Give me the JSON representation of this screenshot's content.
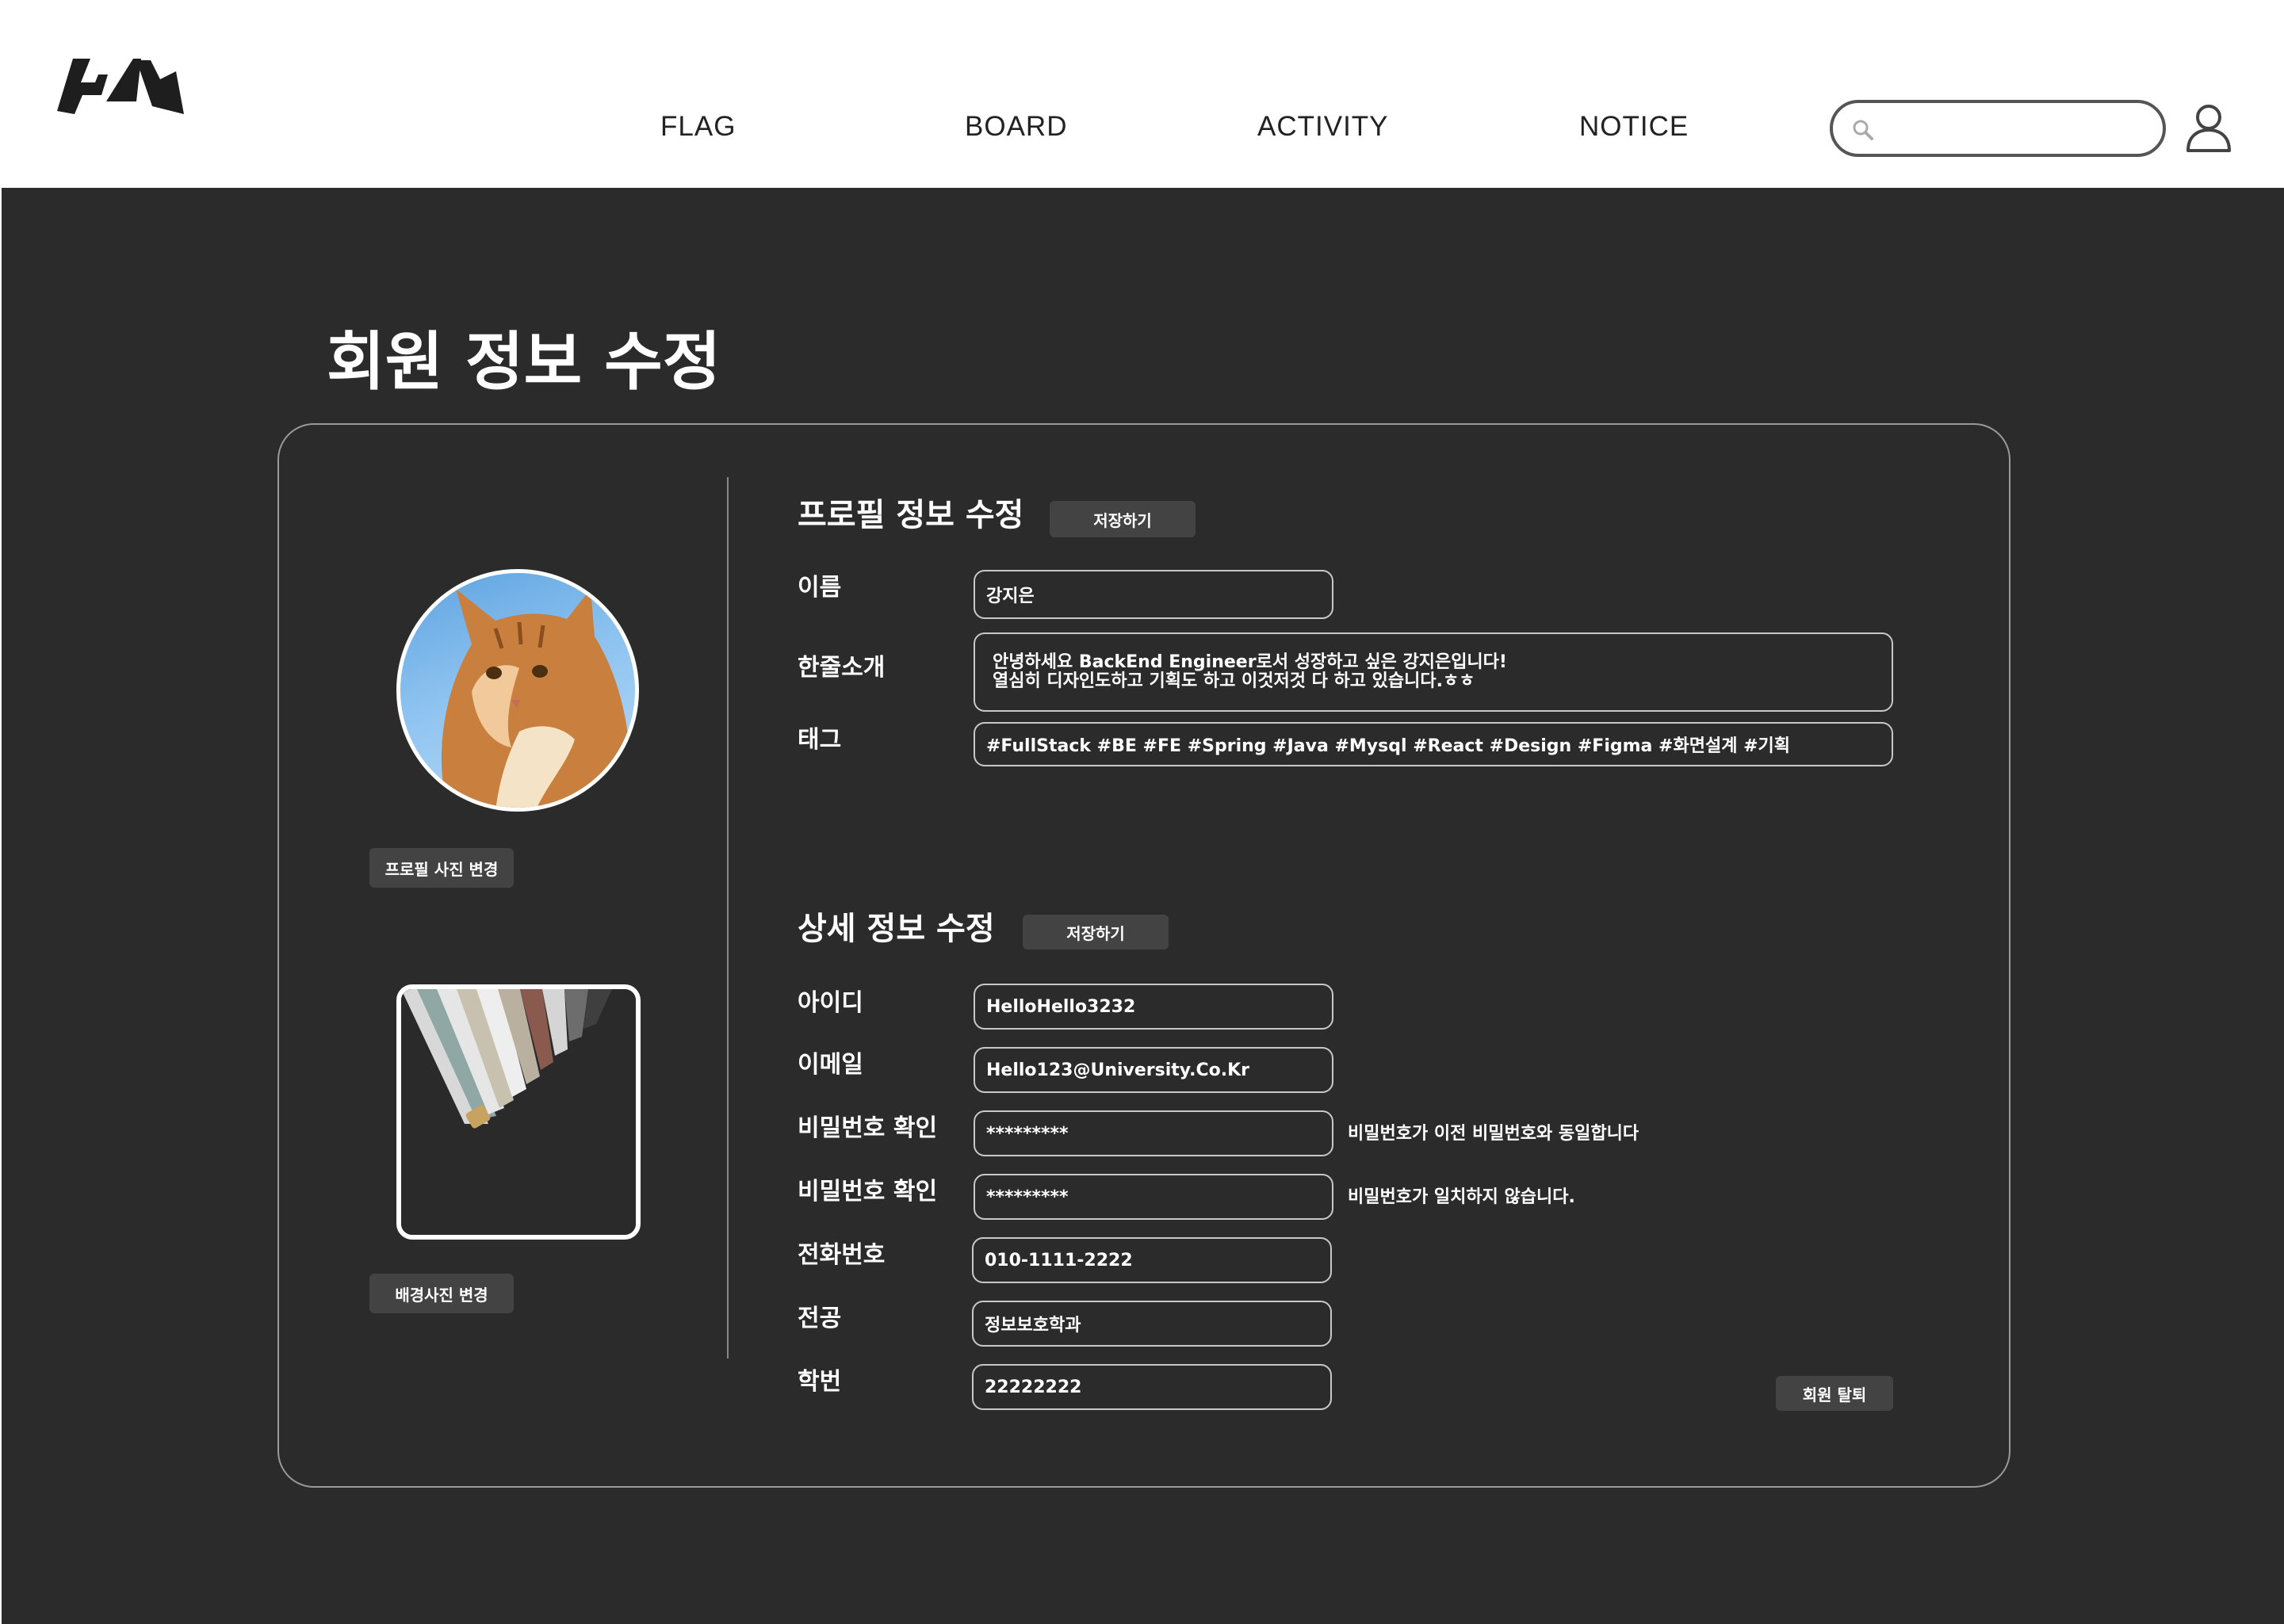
{
  "header": {
    "nav": [
      "FLAG",
      "BOARD",
      "ACTIVITY",
      "NOTICE"
    ],
    "search": {
      "value": "",
      "placeholder": ""
    }
  },
  "page": {
    "title": "회원 정보 수정"
  },
  "left_panel": {
    "profile_photo_button": "프로필 사진 변경",
    "background_photo_button": "배경사진  변경"
  },
  "profile_section": {
    "title": "프로필 정보 수정",
    "save_label": "저장하기",
    "fields": {
      "name": {
        "label": "이름",
        "value": "강지은"
      },
      "intro": {
        "label": "한줄소개",
        "line1": "안녕하세요  BackEnd Engineer로서 성장하고 싶은 강지은입니다!",
        "line2": "열심히 디자인도하고 기획도 하고 이것저것 다 하고 있습니다.ㅎㅎ"
      },
      "tags": {
        "label": "태그",
        "value": "#FullStack #BE #FE #Spring #Java #Mysql #React #Design #Figma #화면설계 #기획"
      }
    }
  },
  "detail_section": {
    "title": "상세 정보 수정",
    "save_label": "저장하기",
    "fields": {
      "user_id": {
        "label": "아이디",
        "value": "HelloHello3232"
      },
      "email": {
        "label": "이메일",
        "value": "Hello123@University.Co.Kr"
      },
      "password_confirm_1": {
        "label": "비밀번호 확인",
        "value": "*********",
        "hint": "비밀번호가 이전 비밀번호와 동일합니다"
      },
      "password_confirm_2": {
        "label": "비밀번호 확인",
        "value": "*********",
        "hint": "비밀번호가 일치하지 않습니다."
      },
      "phone": {
        "label": "전화번호",
        "value": "010-1111-2222"
      },
      "major": {
        "label": "전공",
        "value": "정보보호학과"
      },
      "student_no": {
        "label": "학번",
        "value": "22222222"
      }
    },
    "withdraw_label": "회원 탈퇴"
  }
}
